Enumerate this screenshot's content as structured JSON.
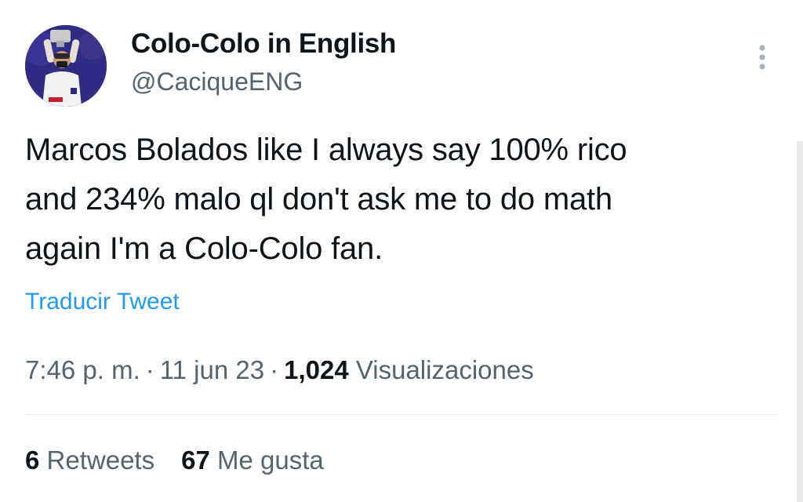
{
  "account": {
    "display_name": "Colo-Colo in English",
    "handle": "@CaciqueENG",
    "avatar_icon": "person-holding-trophy-avatar"
  },
  "more_icon": "more-vertical-icon",
  "tweet": {
    "text": "Marcos Bolados like I always say 100% rico\nand 234% malo ql don't ask me to do math\nagain I'm a Colo-Colo fan.",
    "translate_label": "Traducir Tweet"
  },
  "meta": {
    "time": "7:46 p. m.",
    "separator": "·",
    "date": "11 jun 23",
    "views_count": "1,024",
    "views_label": "Visualizaciones"
  },
  "stats": {
    "retweets_count": "6",
    "retweets_label": "Retweets",
    "likes_count": "67",
    "likes_label": "Me gusta"
  },
  "colors": {
    "link": "#1d9bf0",
    "secondary_text": "#536471",
    "primary_text": "#0f1419",
    "divider": "#e6ecf0"
  }
}
